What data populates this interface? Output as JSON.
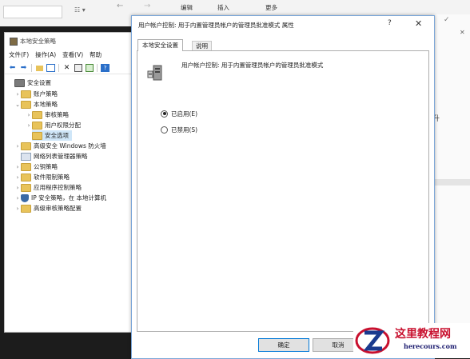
{
  "background": {
    "view_label": "☷ ▾",
    "tab_edit": "编辑",
    "tab_insert": "插入",
    "tab_more": "更多",
    "right_text": "升"
  },
  "lsp": {
    "title": "本地安全策略",
    "menu": [
      "文件(F)",
      "操作(A)",
      "查看(V)",
      "帮助"
    ],
    "tree": [
      {
        "label": "安全设置",
        "indent": 0,
        "chevron": "",
        "icon": "security-settings-icon"
      },
      {
        "label": "账户策略",
        "indent": 1,
        "chevron": ">",
        "icon": "folder-icon"
      },
      {
        "label": "本地策略",
        "indent": 1,
        "chevron": "v",
        "icon": "folder-icon"
      },
      {
        "label": "审核策略",
        "indent": 2,
        "chevron": ">",
        "icon": "folder-icon"
      },
      {
        "label": "用户权限分配",
        "indent": 2,
        "chevron": ">",
        "icon": "folder-icon"
      },
      {
        "label": "安全选项",
        "indent": 2,
        "chevron": "",
        "icon": "folder-icon",
        "selected": true
      },
      {
        "label": "高级安全 Windows 防火墙",
        "indent": 1,
        "chevron": ">",
        "icon": "folder-icon"
      },
      {
        "label": "网络列表管理器策略",
        "indent": 1,
        "chevron": "",
        "icon": "netfolder-icon"
      },
      {
        "label": "公钥策略",
        "indent": 1,
        "chevron": ">",
        "icon": "folder-icon"
      },
      {
        "label": "软件限制策略",
        "indent": 1,
        "chevron": ">",
        "icon": "folder-icon"
      },
      {
        "label": "应用程序控制策略",
        "indent": 1,
        "chevron": ">",
        "icon": "folder-icon"
      },
      {
        "label": "IP 安全策略，在 本地计算机",
        "indent": 1,
        "chevron": ">",
        "icon": "shield-icon"
      },
      {
        "label": "高级审核策略配置",
        "indent": 1,
        "chevron": ">",
        "icon": "folder-icon"
      }
    ]
  },
  "dialog": {
    "title": "用户帐户控制: 用于内置管理员帐户的管理员批准模式 属性",
    "help": "?",
    "close": "✕",
    "tabs": [
      "本地安全设置",
      "说明"
    ],
    "policy_name": "用户帐户控制: 用于内置管理员帐户的管理员批准模式",
    "option_enabled": "已启用(E)",
    "option_disabled": "已禁用(S)",
    "selected_option": "enabled",
    "ok_label": "确定",
    "cancel_label": "取消"
  },
  "watermark": {
    "title": "这里教程网",
    "url": "herecours.com"
  }
}
